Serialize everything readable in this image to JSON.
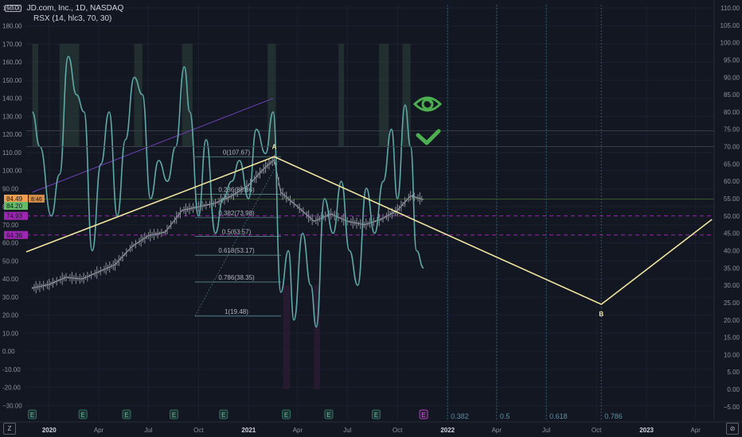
{
  "header": {
    "currency_badge": "USD",
    "title": "JD.com, Inc., 1D, NASDAQ",
    "indicator": "RSX (14, hlc3, 70, 30)"
  },
  "corner_left": "Z",
  "corner_right": "⊘",
  "icons": [
    "eye-icon",
    "check-icon"
  ],
  "colors": {
    "background": "#131722",
    "zigzag": "#f0e6a0",
    "rsx": "#5fa8a8",
    "rsx_low": "#8a2d6e",
    "purple_level": "#9c27b0",
    "accent_green": "#4caf50",
    "price_tag_1": "#f0a050",
    "price_tag_2": "#66bb6a"
  },
  "chart_data": {
    "type": "line",
    "title": "JD.com, Inc., 1D, NASDAQ",
    "left_axis": {
      "ticks": [
        190,
        180,
        170,
        160,
        150,
        140,
        130,
        120,
        110,
        100,
        90,
        80,
        70,
        60,
        50,
        40,
        30,
        20,
        10,
        0,
        -10,
        -20,
        -30
      ],
      "labels": [
        "190.00",
        "180.00",
        "170.00",
        "160.00",
        "150.00",
        "140.00",
        "130.00",
        "120.00",
        "110.00",
        "100.00",
        "90.00",
        "80.00",
        "70.00",
        "60.00",
        "50.00",
        "40.00",
        "30.00",
        "20.00",
        "10.00",
        "0.00",
        "-10.00",
        "-20.00",
        "−30.00"
      ]
    },
    "right_axis": {
      "ticks": [
        110,
        105,
        100,
        95,
        90,
        85,
        80,
        75,
        70,
        65,
        60,
        55,
        50,
        45,
        40,
        35,
        30,
        25,
        20,
        15,
        10,
        5,
        0,
        -5
      ],
      "labels": [
        "110.00",
        "105.00",
        "100.00",
        "95.00",
        "90.00",
        "85.00",
        "80.00",
        "75.00",
        "70.00",
        "65.00",
        "60.00",
        "55.00",
        "50.00",
        "45.00",
        "40.00",
        "35.00",
        "30.00",
        "25.00",
        "20.00",
        "15.00",
        "10.00",
        "5.00",
        "0.00",
        "−5.00"
      ]
    },
    "x_ticks": [
      {
        "date": "2020-01-01",
        "label": "2020",
        "bold": true
      },
      {
        "date": "2020-04-01",
        "label": "Apr"
      },
      {
        "date": "2020-07-01",
        "label": "Jul"
      },
      {
        "date": "2020-10-01",
        "label": "Oct"
      },
      {
        "date": "2021-01-01",
        "label": "2021",
        "bold": true
      },
      {
        "date": "2021-04-01",
        "label": "Apr"
      },
      {
        "date": "2021-07-01",
        "label": "Jul"
      },
      {
        "date": "2021-10-01",
        "label": "Oct"
      },
      {
        "date": "2022-01-01",
        "label": "2022",
        "bold": true
      },
      {
        "date": "2022-04-01",
        "label": "Apr"
      },
      {
        "date": "2022-07-01",
        "label": "Jul"
      },
      {
        "date": "2022-10-01",
        "label": "Oct"
      },
      {
        "date": "2023-01-01",
        "label": "2023",
        "bold": true
      },
      {
        "date": "2023-04-01",
        "label": "Apr"
      }
    ],
    "price_tags": [
      {
        "value": 84.49,
        "label": "84.49",
        "extra": "8:46",
        "color": "#f0a050"
      },
      {
        "value": 80.5,
        "label": "84.20",
        "color": "#66bb6a"
      },
      {
        "value": 74.93,
        "label": "74.93",
        "color": "#9c27b0"
      },
      {
        "value": 64.36,
        "label": "64.36",
        "color": "#9c27b0"
      }
    ],
    "horizontal_levels": [
      {
        "value": 74.93,
        "style": "dashed",
        "color": "#9c27b0"
      },
      {
        "value": 64.36,
        "style": "dashed",
        "color": "#9c27b0"
      },
      {
        "value": 122,
        "style": "solid",
        "color": "#3a3e48"
      },
      {
        "value": 84.2,
        "style": "solid",
        "color": "#3c5a2e"
      }
    ],
    "fibonacci_retracement": {
      "levels": [
        {
          "ratio": 0,
          "price": 107.67,
          "label": "0(107.67)"
        },
        {
          "ratio": 0.236,
          "price": 86.86,
          "label": "0.236(86.86)"
        },
        {
          "ratio": 0.382,
          "price": 73.98,
          "label": "0.382(73.98)"
        },
        {
          "ratio": 0.5,
          "price": 63.57,
          "label": "0.5(63.57)"
        },
        {
          "ratio": 0.618,
          "price": 53.17,
          "label": "0.618(53.17)"
        },
        {
          "ratio": 0.786,
          "price": 38.35,
          "label": "0.786(38.35)"
        },
        {
          "ratio": 1,
          "price": 19.48,
          "label": "1(19.48)"
        }
      ]
    },
    "fib_time_zones": [
      {
        "date": "2022-01-01",
        "label": "0.382"
      },
      {
        "date": "2022-04-01",
        "label": "0.5"
      },
      {
        "date": "2022-07-01",
        "label": "0.618"
      },
      {
        "date": "2022-10-10",
        "label": "0.786"
      }
    ],
    "zigzag": {
      "points": [
        {
          "date": "2019-11-20",
          "price": 55
        },
        {
          "date": "2021-02-17",
          "price": 107.67,
          "label": "A"
        },
        {
          "date": "2022-10-10",
          "price": 26
        },
        {
          "date": "2023-05-01",
          "price": 73
        }
      ]
    },
    "trend_line": {
      "from": {
        "date": "2019-12-01",
        "price": 88
      },
      "to": {
        "date": "2021-02-15",
        "price": 140
      }
    },
    "earnings_markers": [
      "2019-12-01",
      "2020-03-03",
      "2020-05-22",
      "2020-08-17",
      "2020-11-16",
      "2021-03-11",
      "2021-05-28",
      "2021-08-23",
      "2021-11-18"
    ],
    "current_earnings_marker": "2021-11-18",
    "price_series": {
      "name": "JD",
      "points": [
        [
          "2019-12-01",
          35
        ],
        [
          "2020-01-01",
          37
        ],
        [
          "2020-02-01",
          41
        ],
        [
          "2020-03-01",
          40
        ],
        [
          "2020-04-01",
          44
        ],
        [
          "2020-05-01",
          48
        ],
        [
          "2020-06-01",
          58
        ],
        [
          "2020-07-01",
          64
        ],
        [
          "2020-08-01",
          66
        ],
        [
          "2020-09-01",
          78
        ],
        [
          "2020-10-01",
          80
        ],
        [
          "2020-11-01",
          82
        ],
        [
          "2020-12-01",
          86
        ],
        [
          "2021-01-01",
          92
        ],
        [
          "2021-02-01",
          102
        ],
        [
          "2021-02-17",
          106
        ],
        [
          "2021-03-01",
          88
        ],
        [
          "2021-04-01",
          80
        ],
        [
          "2021-05-01",
          72
        ],
        [
          "2021-06-01",
          76
        ],
        [
          "2021-07-01",
          72
        ],
        [
          "2021-08-01",
          70
        ],
        [
          "2021-09-01",
          73
        ],
        [
          "2021-10-01",
          78
        ],
        [
          "2021-10-25",
          86
        ],
        [
          "2021-11-18",
          84
        ]
      ]
    },
    "rsx_series": {
      "name": "RSX",
      "overbought": 70,
      "oversold": 30,
      "points": [
        [
          "2019-12-01",
          80
        ],
        [
          "2019-12-15",
          70
        ],
        [
          "2020-01-05",
          50
        ],
        [
          "2020-01-20",
          62
        ],
        [
          "2020-02-05",
          96
        ],
        [
          "2020-02-20",
          85
        ],
        [
          "2020-03-05",
          80
        ],
        [
          "2020-03-20",
          40
        ],
        [
          "2020-04-05",
          65
        ],
        [
          "2020-04-20",
          80
        ],
        [
          "2020-05-05",
          50
        ],
        [
          "2020-05-20",
          72
        ],
        [
          "2020-06-05",
          90
        ],
        [
          "2020-06-20",
          85
        ],
        [
          "2020-07-05",
          55
        ],
        [
          "2020-07-20",
          66
        ],
        [
          "2020-08-05",
          60
        ],
        [
          "2020-08-20",
          70
        ],
        [
          "2020-09-05",
          93
        ],
        [
          "2020-09-15",
          80
        ],
        [
          "2020-10-01",
          50
        ],
        [
          "2020-10-15",
          72
        ],
        [
          "2020-11-01",
          45
        ],
        [
          "2020-11-15",
          55
        ],
        [
          "2020-12-01",
          60
        ],
        [
          "2020-12-15",
          66
        ],
        [
          "2021-01-01",
          55
        ],
        [
          "2021-01-15",
          75
        ],
        [
          "2021-02-01",
          68
        ],
        [
          "2021-02-15",
          80
        ],
        [
          "2021-03-01",
          28
        ],
        [
          "2021-03-15",
          40
        ],
        [
          "2021-03-25",
          20
        ],
        [
          "2021-04-10",
          45
        ],
        [
          "2021-04-25",
          30
        ],
        [
          "2021-05-05",
          18
        ],
        [
          "2021-05-20",
          55
        ],
        [
          "2021-06-05",
          45
        ],
        [
          "2021-06-20",
          60
        ],
        [
          "2021-07-05",
          40
        ],
        [
          "2021-07-20",
          30
        ],
        [
          "2021-08-05",
          58
        ],
        [
          "2021-08-20",
          45
        ],
        [
          "2021-09-05",
          60
        ],
        [
          "2021-09-20",
          75
        ],
        [
          "2021-10-01",
          55
        ],
        [
          "2021-10-15",
          82
        ],
        [
          "2021-10-25",
          70
        ],
        [
          "2021-11-05",
          40
        ],
        [
          "2021-11-18",
          35
        ]
      ]
    },
    "rsx_highlight_ranges": [
      [
        "2019-12-01",
        "2019-12-12"
      ],
      [
        "2020-01-20",
        "2020-02-25"
      ],
      [
        "2020-06-05",
        "2020-06-20"
      ],
      [
        "2020-09-01",
        "2020-09-20"
      ],
      [
        "2021-02-05",
        "2021-02-20"
      ],
      [
        "2021-06-15",
        "2021-06-25"
      ],
      [
        "2021-08-28",
        "2021-09-15"
      ],
      [
        "2021-10-10",
        "2021-10-25"
      ],
      [
        "2021-03-05",
        "2021-03-18"
      ],
      [
        "2021-05-01",
        "2021-05-12"
      ]
    ]
  }
}
